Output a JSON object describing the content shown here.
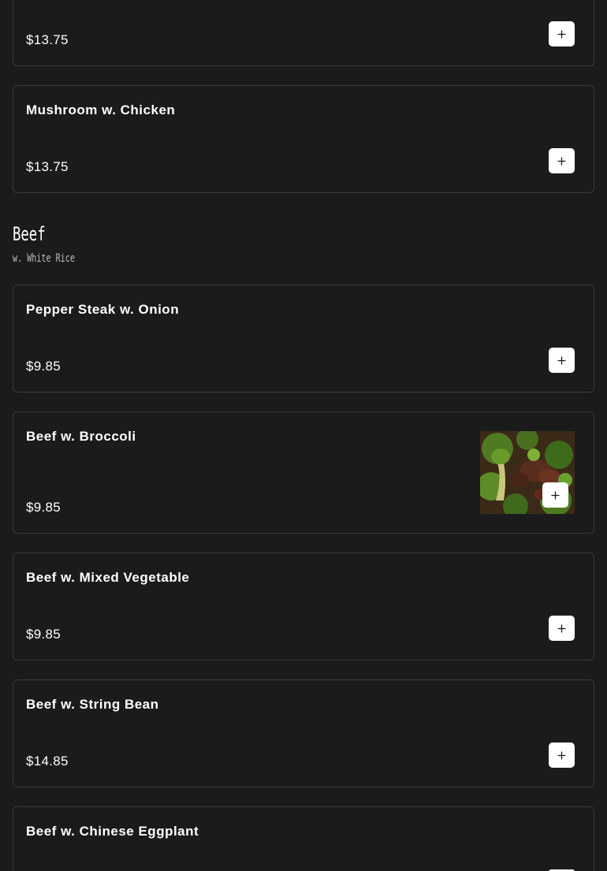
{
  "sections": {
    "prev_items": [
      {
        "name": "",
        "price": "$13.75"
      },
      {
        "name": "Mushroom w. Chicken",
        "price": "$13.75"
      }
    ],
    "beef": {
      "title": "Beef",
      "subtitle": "w. White Rice",
      "items": [
        {
          "name": "Pepper Steak w. Onion",
          "price": "$9.85"
        },
        {
          "name": "Beef w. Broccoli",
          "price": "$9.85",
          "has_image": true
        },
        {
          "name": "Beef w. Mixed Vegetable",
          "price": "$9.85"
        },
        {
          "name": "Beef w. String Bean",
          "price": "$14.85"
        },
        {
          "name": "Beef w. Chinese Eggplant",
          "price": ""
        }
      ]
    }
  },
  "icons": {
    "add": "plus-icon"
  },
  "colors": {
    "background": "#1b1b1b",
    "card_border": "#3a3a3a",
    "button": "#ffffff",
    "text": "#ffffff"
  }
}
